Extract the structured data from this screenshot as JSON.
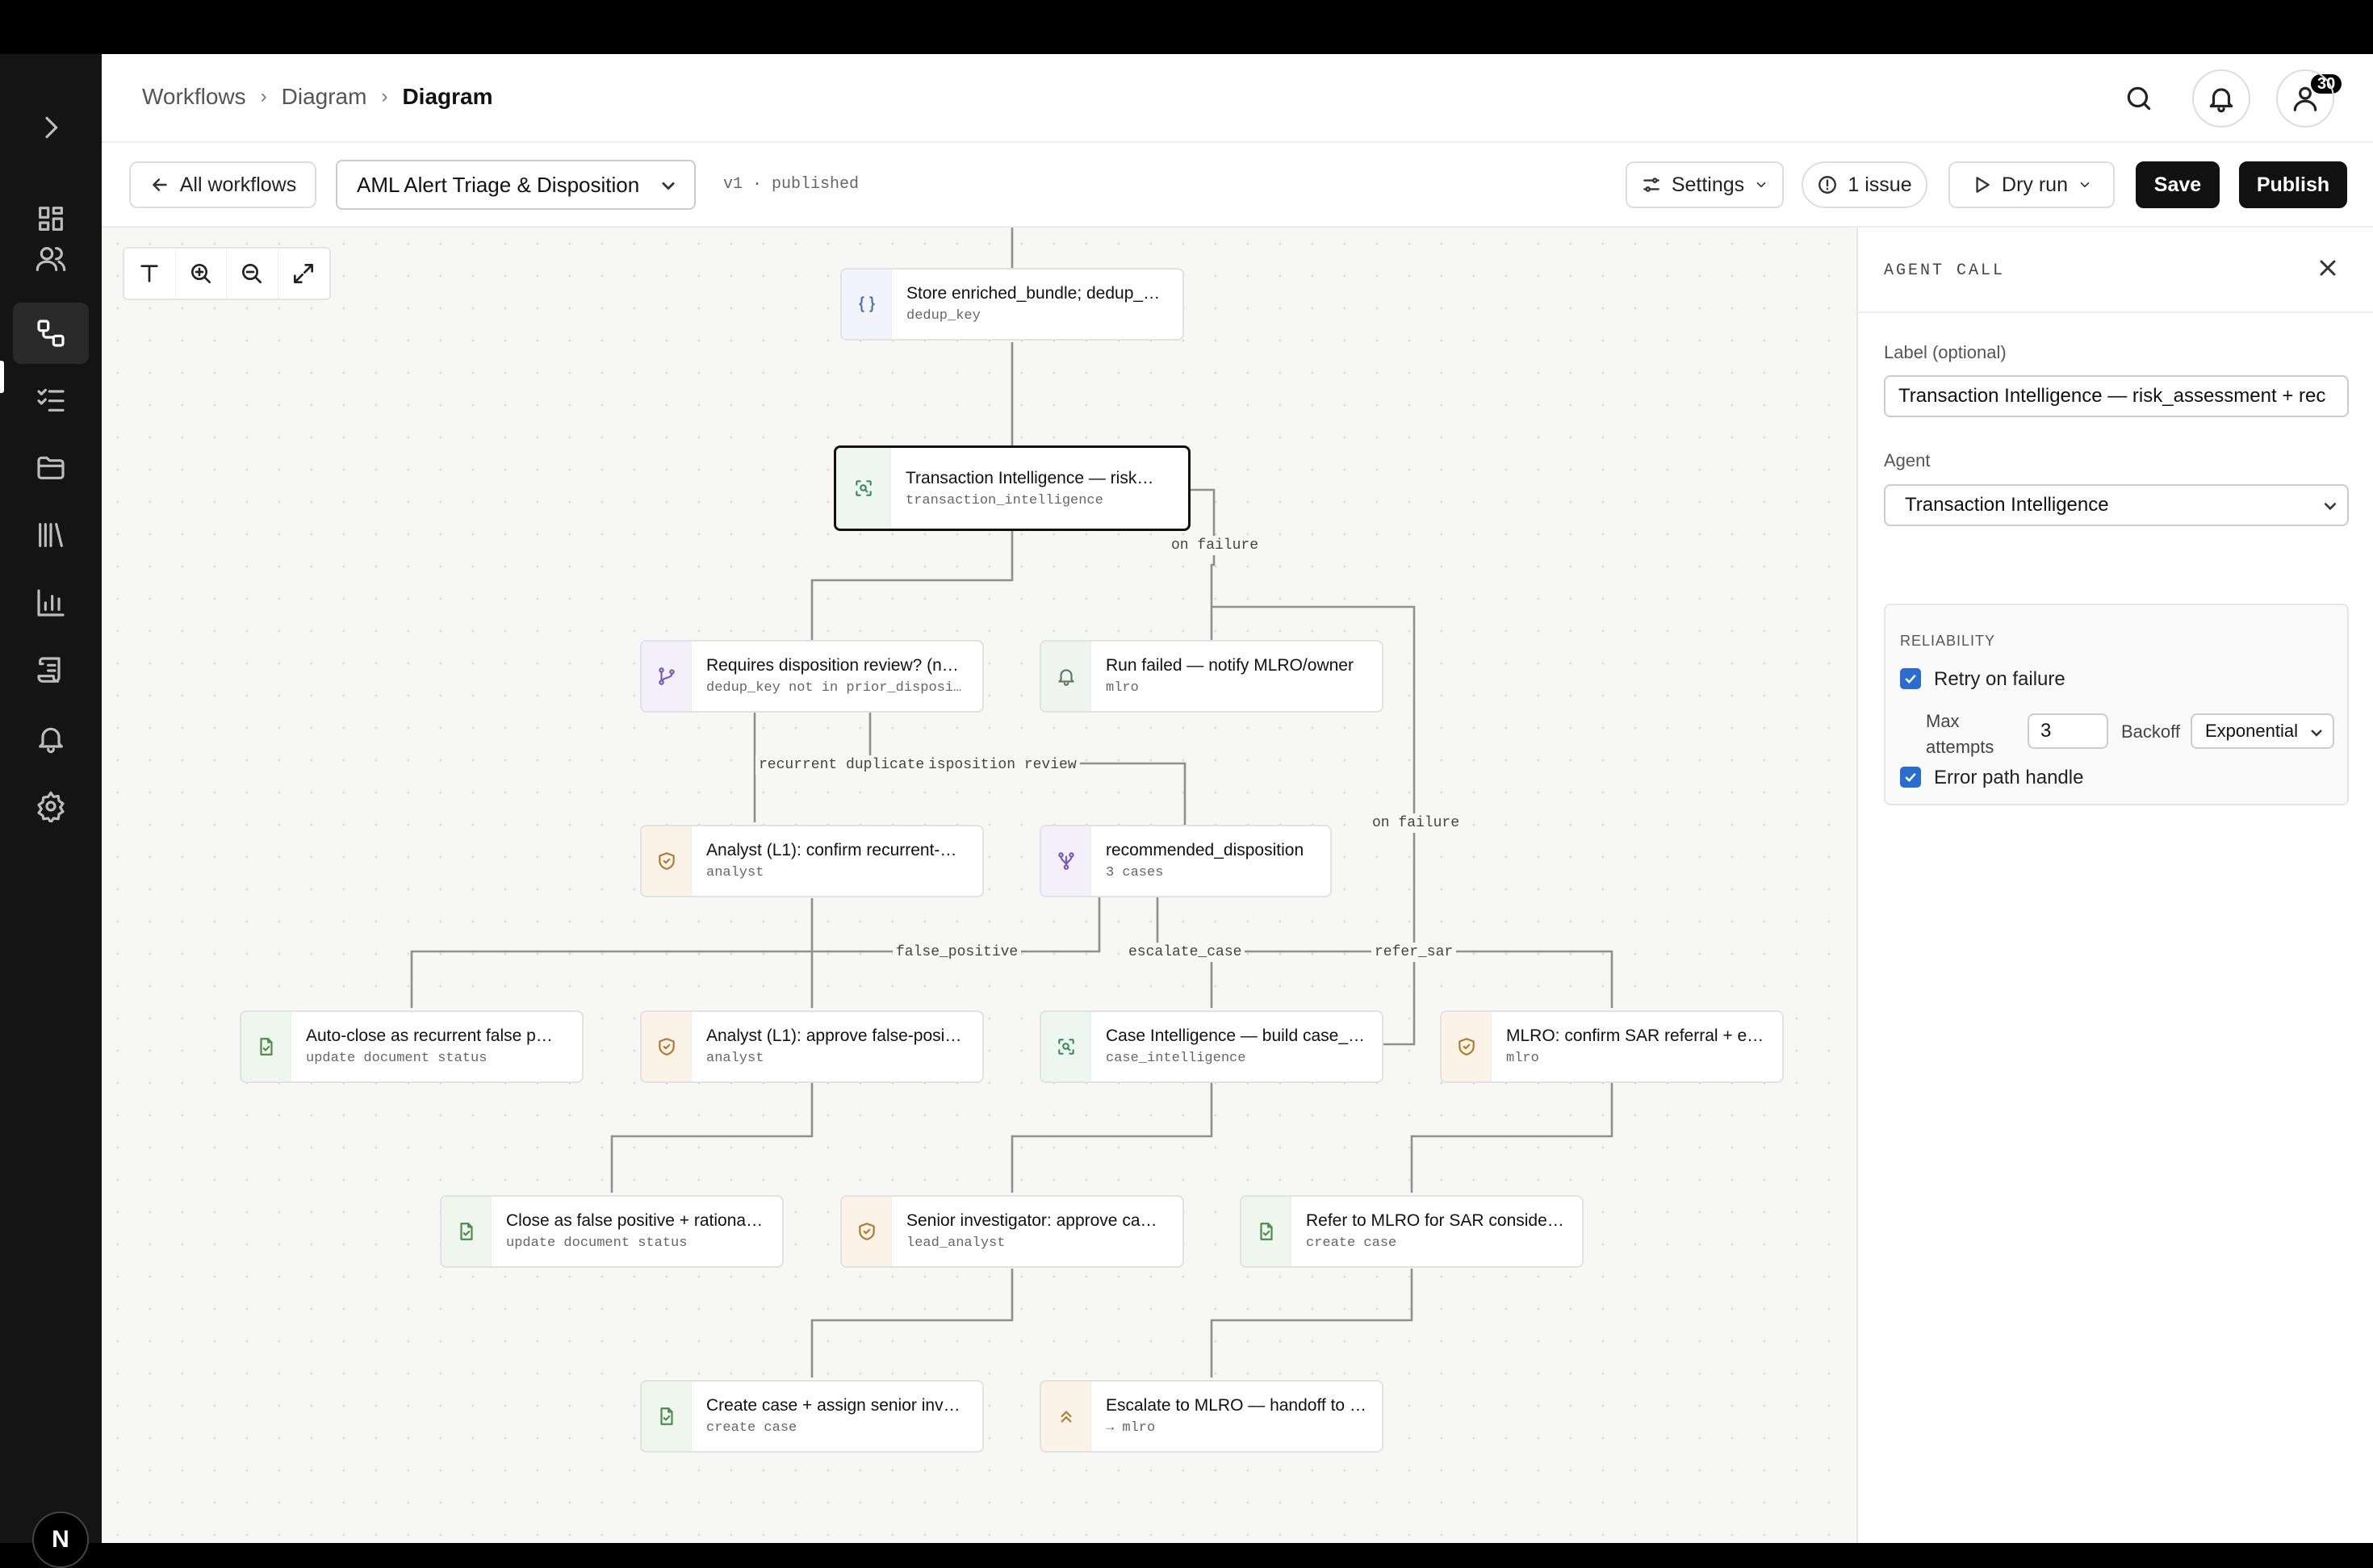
{
  "breadcrumb": {
    "items": [
      "Workflows",
      "Diagram",
      "Diagram"
    ]
  },
  "header": {
    "notification_count": "30"
  },
  "toolbar": {
    "back_label": "All workflows",
    "workflow_name": "AML Alert Triage & Disposition",
    "version": "v1 · published",
    "settings_label": "Settings",
    "issues_label": "1 issue",
    "dry_run_label": "Dry run",
    "save_label": "Save",
    "publish_label": "Publish"
  },
  "nodes": [
    {
      "id": "store",
      "title": "Store enriched_bundle; dedup_…",
      "sub": "dedup_key",
      "icon": "braces-icon"
    },
    {
      "id": "txn",
      "title": "Transaction Intelligence — risk…",
      "sub": "transaction_intelligence",
      "icon": "agent-icon"
    },
    {
      "id": "requires",
      "title": "Requires disposition review? (n…",
      "sub": "dedup_key not in prior_disposi…",
      "icon": "branch-icon"
    },
    {
      "id": "runfailed",
      "title": "Run failed — notify MLRO/owner",
      "sub": "mlro",
      "icon": "bell-icon"
    },
    {
      "id": "analyst1",
      "title": "Analyst (L1): confirm recurrent-…",
      "sub": "analyst",
      "icon": "shield-check-icon"
    },
    {
      "id": "recdisp",
      "title": "recommended_disposition",
      "sub": "3 cases",
      "icon": "switch-icon"
    },
    {
      "id": "autoclose",
      "title": "Auto-close as recurrent false p…",
      "sub": "update document status",
      "icon": "doc-check-icon"
    },
    {
      "id": "analyst2",
      "title": "Analyst (L1): approve false-posi…",
      "sub": "analyst",
      "icon": "shield-check-icon"
    },
    {
      "id": "caseint",
      "title": "Case Intelligence — build case_…",
      "sub": "case_intelligence",
      "icon": "agent-icon"
    },
    {
      "id": "mlroconfirm",
      "title": "MLRO: confirm SAR referral + e…",
      "sub": "mlro",
      "icon": "shield-check-icon"
    },
    {
      "id": "closefp",
      "title": "Close as false positive + rationa…",
      "sub": "update document status",
      "icon": "doc-check-icon"
    },
    {
      "id": "senior",
      "title": "Senior investigator: approve ca…",
      "sub": "lead_analyst",
      "icon": "shield-check-icon"
    },
    {
      "id": "refer",
      "title": "Refer to MLRO for SAR conside…",
      "sub": "create case",
      "icon": "doc-check-icon"
    },
    {
      "id": "createcase",
      "title": "Create case + assign senior inv…",
      "sub": "create case",
      "icon": "doc-check-icon"
    },
    {
      "id": "escalate",
      "title": "Escalate to MLRO — handoff to …",
      "sub": "→ mlro",
      "icon": "chevrons-up-icon"
    }
  ],
  "edge_labels": {
    "on_failure_1": "on failure",
    "recurrent": "recurrent duplicate",
    "disposition_review": "isposition review",
    "on_failure_2": "on failure",
    "false_positive": "false_positive",
    "escalate_case": "escalate_case",
    "refer_sar": "refer_sar"
  },
  "panel": {
    "title": "AGENT CALL",
    "label_caption": "Label (optional)",
    "label_value": "Transaction Intelligence — risk_assessment + rec",
    "agent_caption": "Agent",
    "agent_value": "Transaction Intelligence",
    "reliability_title": "RELIABILITY",
    "retry_label": "Retry on failure",
    "retry_checked": true,
    "max_attempts_label": "Max attempts",
    "max_attempts_value": "3",
    "backoff_label": "Backoff",
    "backoff_value": "Exponential",
    "error_path_label": "Error path handle",
    "error_path_checked": true
  },
  "sidebar": {
    "logo": "N"
  },
  "colors": {
    "accent": "#2a6ccf",
    "sidebar_bg": "#141414",
    "canvas_bg": "#f7f7f6"
  }
}
